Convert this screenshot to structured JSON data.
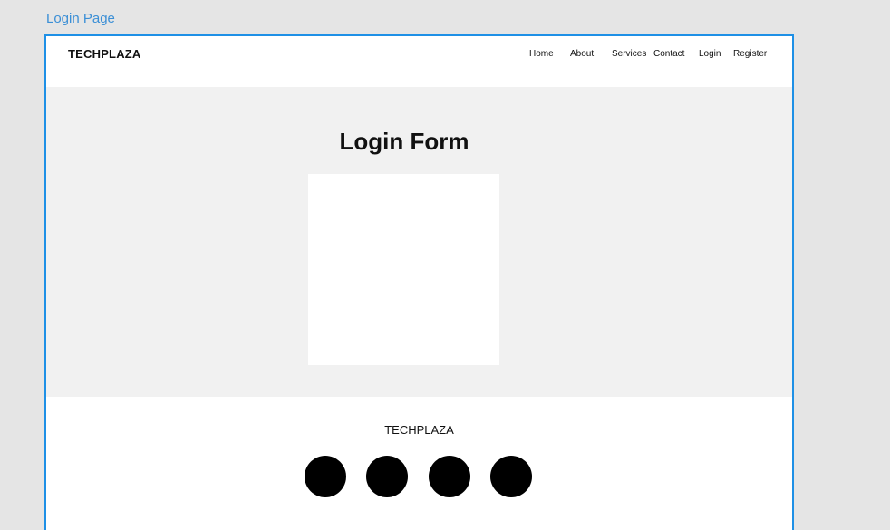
{
  "frame": {
    "label": "Login Page"
  },
  "navbar": {
    "brand": "TECHPLAZA",
    "links": [
      {
        "label": "Home"
      },
      {
        "label": "About"
      },
      {
        "label": "Services"
      },
      {
        "label": "Contact"
      },
      {
        "label": "Login"
      },
      {
        "label": "Register"
      }
    ]
  },
  "hero": {
    "title": "Login Form"
  },
  "footer": {
    "brand": "TECHPLAZA",
    "social_icons": [
      "social-icon",
      "social-icon",
      "social-icon",
      "social-icon"
    ]
  },
  "colors": {
    "frame_border": "#1e90e6",
    "frame_label": "#3b8fd6",
    "hero_background": "#f1f1f1",
    "canvas_background": "#e5e5e5"
  }
}
